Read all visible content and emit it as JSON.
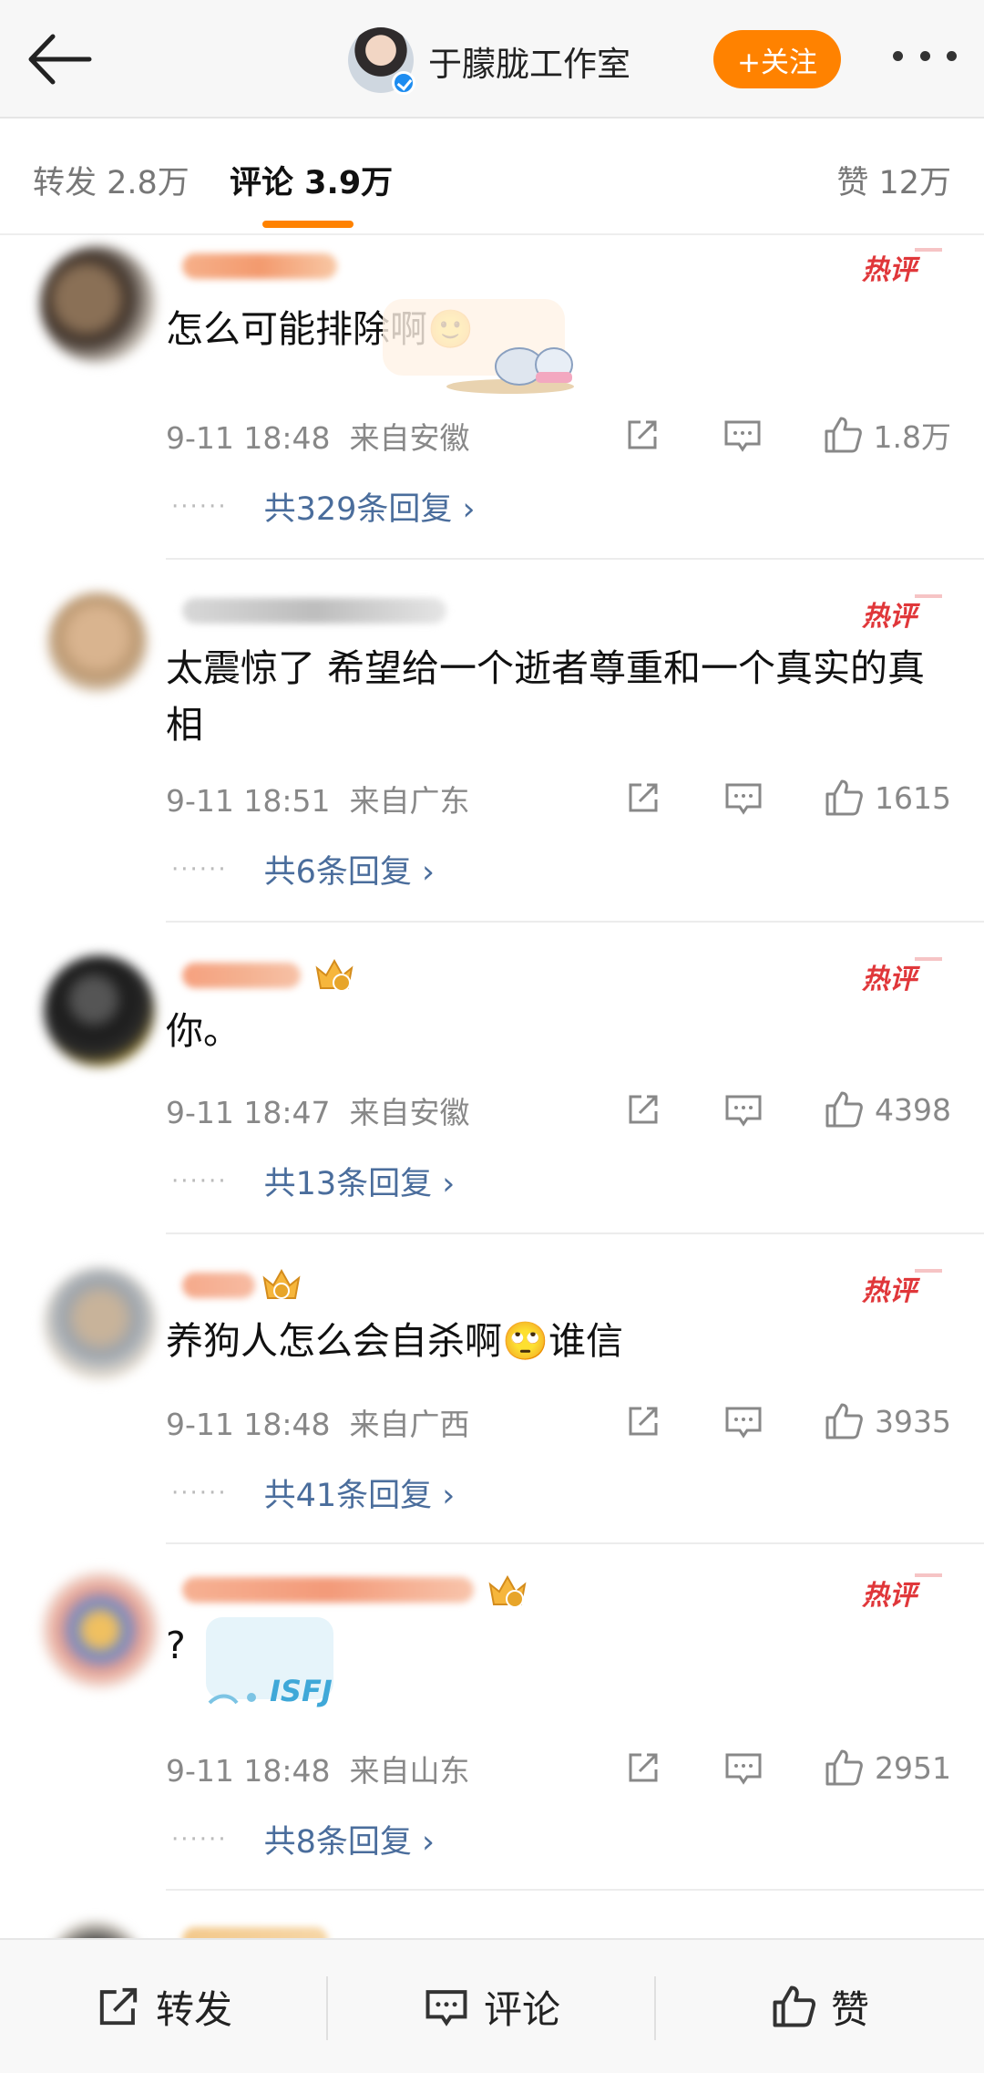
{
  "header": {
    "title": "于朦胧工作室",
    "follow_label": "+关注"
  },
  "tabs": {
    "repost": "转发 2.8万",
    "comment": "评论 3.9万",
    "like": "赞 12万"
  },
  "hot_label": "热评",
  "comments": [
    {
      "text": "怎么可能排除啊🙂",
      "time": "9-11 18:48",
      "location": "来自安徽",
      "likes": "1.8万",
      "replies": "共329条回复 ›",
      "has_crown": false
    },
    {
      "text": "太震惊了 希望给一个逝者尊重和一个真实的真相",
      "time": "9-11 18:51",
      "location": "来自广东",
      "likes": "1615",
      "replies": "共6条回复 ›",
      "has_crown": false
    },
    {
      "text": "你。",
      "time": "9-11 18:47",
      "location": "来自安徽",
      "likes": "4398",
      "replies": "共13条回复 ›",
      "has_crown": true
    },
    {
      "text": "养狗人怎么会自杀啊🙄谁信",
      "time": "9-11 18:48",
      "location": "来自广西",
      "likes": "3935",
      "replies": "共41条回复 ›",
      "has_crown": true
    },
    {
      "text": "?",
      "time": "9-11 18:48",
      "location": "来自山东",
      "likes": "2951",
      "replies": "共8条回复 ›",
      "has_crown": true
    }
  ],
  "sticker_text": "ISFJ",
  "bottom": {
    "repost": "转发",
    "comment": "评论",
    "like": "赞"
  },
  "colors": {
    "accent": "#ff8200",
    "link": "#4a6d9c",
    "hot": "#e0373a"
  }
}
